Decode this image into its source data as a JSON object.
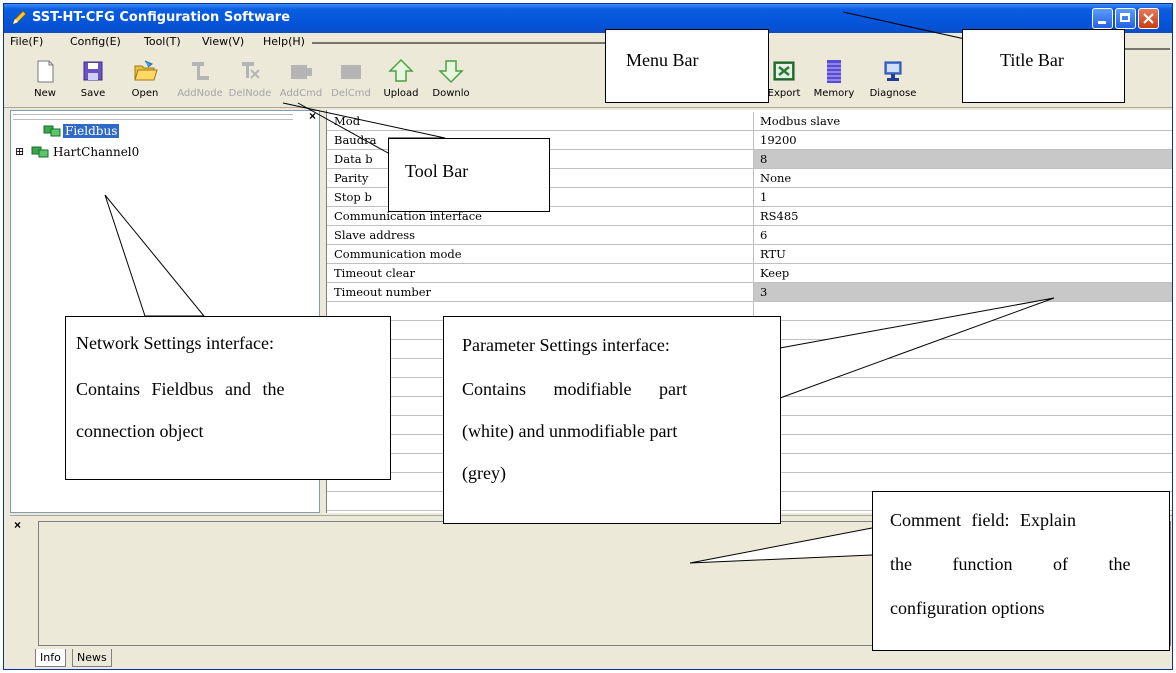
{
  "window": {
    "title": "SST-HT-CFG Configuration Software",
    "accent": "#0553d8"
  },
  "menubar": {
    "items": [
      "File(F)",
      "Config(E)",
      "Tool(T)",
      "View(V)",
      "Help(H)"
    ]
  },
  "toolbar": {
    "items": [
      {
        "label": "New",
        "icon": "new-file-icon",
        "enabled": true
      },
      {
        "label": "Save",
        "icon": "save-icon",
        "enabled": true
      },
      {
        "label": "Open",
        "icon": "open-folder-icon",
        "enabled": true
      },
      {
        "label": "AddNode",
        "icon": "add-node-icon",
        "enabled": false
      },
      {
        "label": "DelNode",
        "icon": "delete-node-icon",
        "enabled": false
      },
      {
        "label": "AddCmd",
        "icon": "add-command-icon",
        "enabled": false
      },
      {
        "label": "DelCmd",
        "icon": "delete-command-icon",
        "enabled": false
      },
      {
        "label": "Upload",
        "icon": "upload-icon",
        "enabled": true
      },
      {
        "label": "Downlo",
        "icon": "download-icon",
        "enabled": true
      },
      {
        "label": "Export",
        "icon": "export-icon",
        "enabled": true
      },
      {
        "label": "Memory",
        "icon": "memory-icon",
        "enabled": true
      },
      {
        "label": "Diagnose",
        "icon": "diagnose-icon",
        "enabled": true
      }
    ]
  },
  "tree": {
    "nodes": [
      {
        "label": "Fieldbus",
        "selected": true
      },
      {
        "label": "HartChannel0",
        "selected": false,
        "expander": "⊞"
      }
    ]
  },
  "properties": {
    "rows": [
      {
        "name": "Mod",
        "value": "Modbus slave",
        "editable": true
      },
      {
        "name": "Baudra",
        "value": "19200",
        "editable": true
      },
      {
        "name": "Data b",
        "value": "8",
        "editable": false
      },
      {
        "name": "Parity",
        "value": "None",
        "editable": true
      },
      {
        "name": "Stop b",
        "value": "1",
        "editable": true
      },
      {
        "name": "Communication interface",
        "value": "RS485",
        "editable": true
      },
      {
        "name": "Slave address",
        "value": "6",
        "editable": true
      },
      {
        "name": "Communication mode",
        "value": "RTU",
        "editable": true
      },
      {
        "name": "Timeout clear",
        "value": "Keep",
        "editable": true
      },
      {
        "name": "Timeout number",
        "value": "3",
        "editable": false
      }
    ]
  },
  "bottom_tabs": [
    "Info",
    "News"
  ],
  "callouts": {
    "menu_bar": "Menu Bar",
    "title_bar": "Title Bar",
    "tool_bar": "Tool Bar",
    "network": [
      "Network Settings interface:",
      "Contains Fieldbus and the",
      "connection object"
    ],
    "parameter": [
      "Parameter Settings interface:",
      "Contains modifiable part",
      "(white) and unmodifiable part",
      "(grey)"
    ],
    "comment": [
      "Comment field: Explain",
      "the function of the",
      "configuration options"
    ]
  }
}
